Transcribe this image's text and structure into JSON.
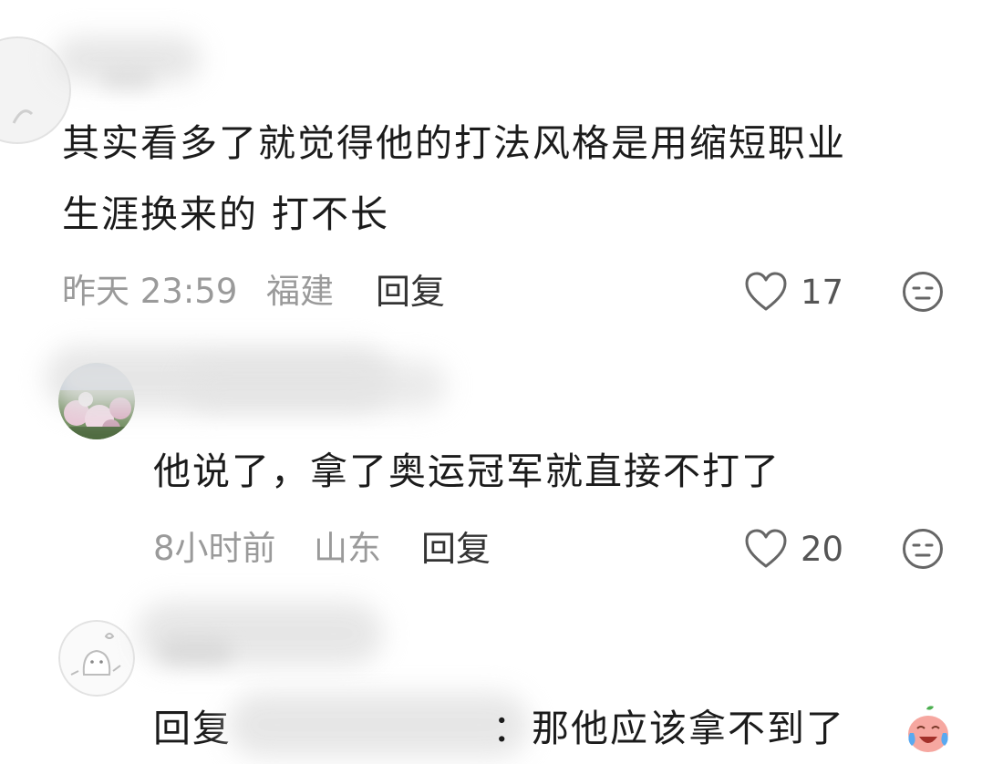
{
  "comments": [
    {
      "text_line1": "其实看多了就觉得他的打法风格是用缩短职业",
      "text_line2": "生涯换来的 打不长",
      "time": "昨天 23:59",
      "location": "福建",
      "reply_label": "回复",
      "likes": "17"
    },
    {
      "text": "他说了，拿了奥运冠军就直接不打了",
      "time": "8小时前",
      "location": "山东",
      "reply_label": "回复",
      "likes": "20"
    },
    {
      "text_prefix": "回复",
      "text_suffix": "：那他应该拿不到了"
    }
  ],
  "icons": {
    "like": "heart-outline-icon",
    "reaction": "neutral-face-icon",
    "emoji": "crying-laughing-emoji"
  },
  "colors": {
    "meta": "#9a9a9a",
    "text": "#1b1b1b",
    "icon": "#666666"
  }
}
